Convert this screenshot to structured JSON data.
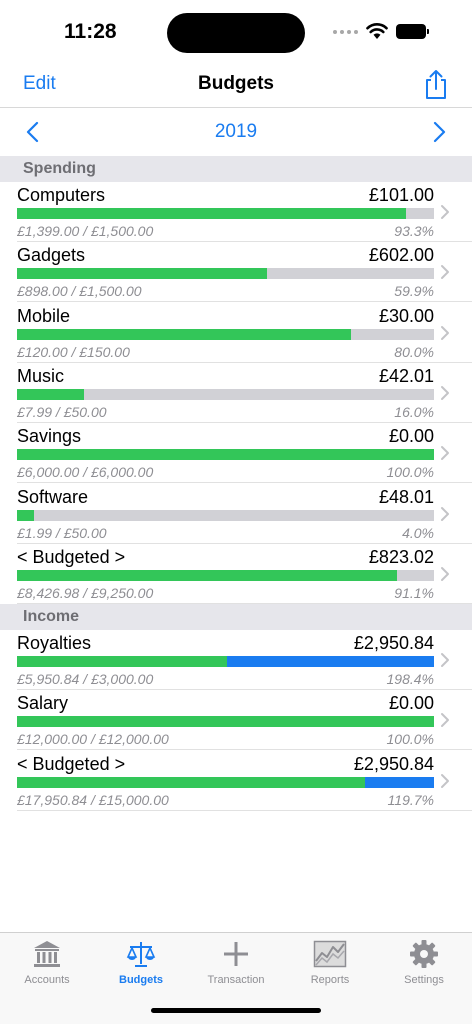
{
  "status": {
    "time": "11:28"
  },
  "nav": {
    "edit_label": "Edit",
    "title": "Budgets",
    "share_icon": "share-icon"
  },
  "year": {
    "label": "2019"
  },
  "colors": {
    "accent": "#1a7cf0",
    "progress": "#33c659",
    "over": "#1a7cf0",
    "track": "#d1d1d6"
  },
  "spending": {
    "header": "Spending",
    "rows": [
      {
        "name": "Computers",
        "amount": "£101.00",
        "detail": "£1,399.00 / £1,500.00",
        "pct": "93.3%",
        "progress": 0.933
      },
      {
        "name": "Gadgets",
        "amount": "£602.00",
        "detail": "£898.00 / £1,500.00",
        "pct": "59.9%",
        "progress": 0.599
      },
      {
        "name": "Mobile",
        "amount": "£30.00",
        "detail": "£120.00 / £150.00",
        "pct": "80.0%",
        "progress": 0.8
      },
      {
        "name": "Music",
        "amount": "£42.01",
        "detail": "£7.99 / £50.00",
        "pct": "16.0%",
        "progress": 0.16
      },
      {
        "name": "Savings",
        "amount": "£0.00",
        "detail": "£6,000.00 / £6,000.00",
        "pct": "100.0%",
        "progress": 1.0
      },
      {
        "name": "Software",
        "amount": "£48.01",
        "detail": "£1.99 / £50.00",
        "pct": "4.0%",
        "progress": 0.04
      },
      {
        "name": "< Budgeted >",
        "amount": "£823.02",
        "detail": "£8,426.98 / £9,250.00",
        "pct": "91.1%",
        "progress": 0.911
      }
    ]
  },
  "income": {
    "header": "Income",
    "rows": [
      {
        "name": "Royalties",
        "amount": "£2,950.84",
        "detail": "£5,950.84 / £3,000.00",
        "pct": "198.4%",
        "progress": 1.984
      },
      {
        "name": "Salary",
        "amount": "£0.00",
        "detail": "£12,000.00 / £12,000.00",
        "pct": "100.0%",
        "progress": 1.0
      },
      {
        "name": "< Budgeted >",
        "amount": "£2,950.84",
        "detail": "£17,950.84 / £15,000.00",
        "pct": "119.7%",
        "progress": 1.197
      }
    ]
  },
  "tabs": [
    {
      "label": "Accounts",
      "icon": "bank-icon",
      "active": false
    },
    {
      "label": "Budgets",
      "icon": "scales-icon",
      "active": true
    },
    {
      "label": "Transaction",
      "icon": "plus-icon",
      "active": false
    },
    {
      "label": "Reports",
      "icon": "chart-icon",
      "active": false
    },
    {
      "label": "Settings",
      "icon": "gear-icon",
      "active": false
    }
  ]
}
